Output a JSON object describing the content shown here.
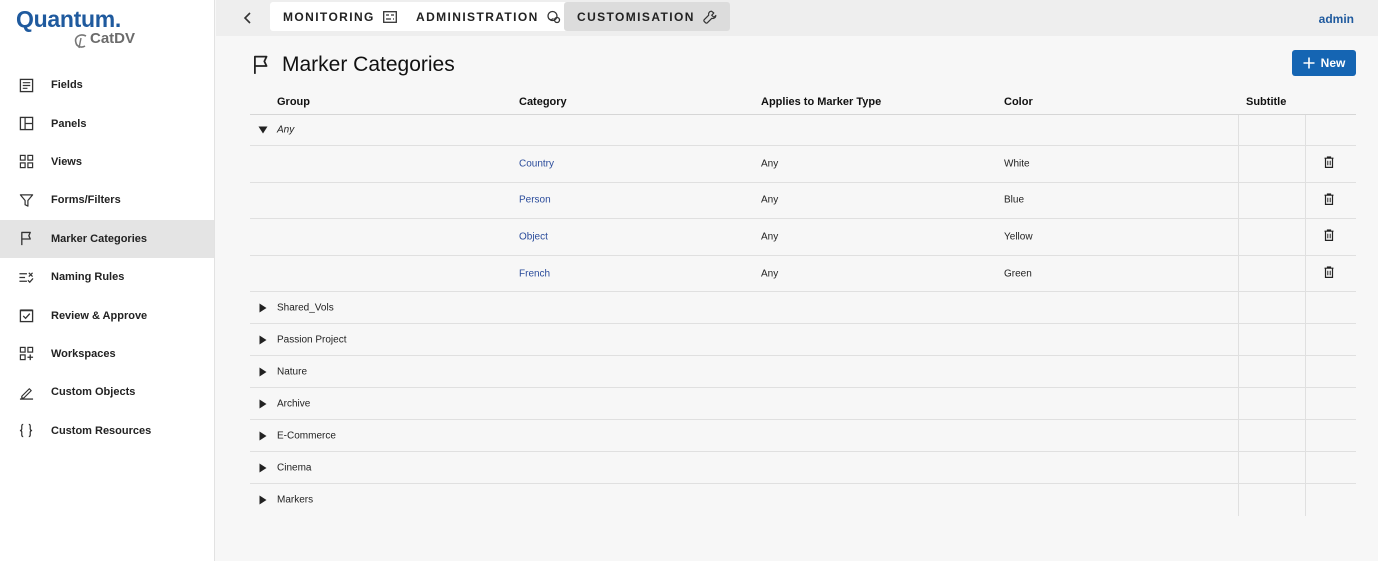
{
  "logo": {
    "main": "Quantum.",
    "sub": "CatDV"
  },
  "sidebar": {
    "items": [
      {
        "label": "Fields",
        "icon": "document-icon"
      },
      {
        "label": "Panels",
        "icon": "panels-icon"
      },
      {
        "label": "Views",
        "icon": "grid-icon"
      },
      {
        "label": "Forms/Filters",
        "icon": "filter-icon"
      },
      {
        "label": "Marker Categories",
        "icon": "flag-icon",
        "active": true
      },
      {
        "label": "Naming Rules",
        "icon": "naming-rules-icon"
      },
      {
        "label": "Review & Approve",
        "icon": "checkbox-icon"
      },
      {
        "label": "Workspaces",
        "icon": "workspaces-icon"
      },
      {
        "label": "Custom Objects",
        "icon": "pen-icon"
      },
      {
        "label": "Custom Resources",
        "icon": "braces-icon"
      }
    ]
  },
  "topbar": {
    "tabs": [
      {
        "label": "MONITORING",
        "icon": "monitor-settings-icon"
      },
      {
        "label": "ADMINISTRATION",
        "icon": "admin-settings-icon"
      },
      {
        "label": "CUSTOMISATION",
        "icon": "wrench-icon",
        "active": true
      }
    ],
    "user": "admin"
  },
  "page": {
    "title": "Marker Categories",
    "new_label": "New"
  },
  "table": {
    "columns": [
      "Group",
      "Category",
      "Applies to Marker Type",
      "Color",
      "Subtitle"
    ],
    "expanded_group": "Any",
    "rows": [
      {
        "category": "Country",
        "applies": "Any",
        "color": "White"
      },
      {
        "category": "Person",
        "applies": "Any",
        "color": "Blue"
      },
      {
        "category": "Object",
        "applies": "Any",
        "color": "Yellow"
      },
      {
        "category": "French",
        "applies": "Any",
        "color": "Green"
      }
    ],
    "collapsed_groups": [
      "Shared_Vols",
      "Passion Project",
      "Nature",
      "Archive",
      "E-Commerce",
      "Cinema",
      "Markers"
    ]
  },
  "colors": {
    "accent": "#1565b3",
    "link": "#2b4c9b",
    "brand": "#1f5a9e"
  }
}
